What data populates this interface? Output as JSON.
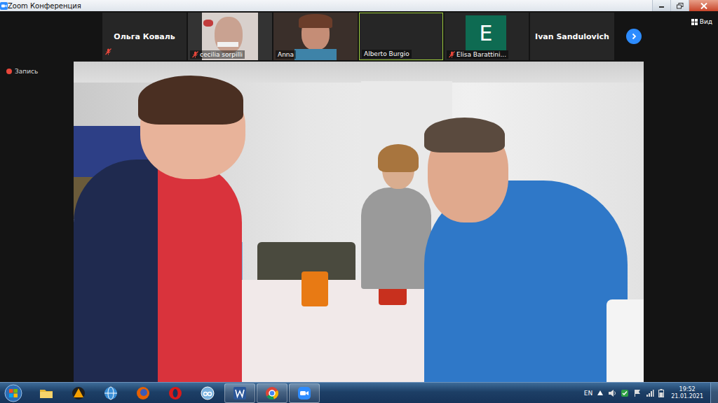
{
  "window": {
    "title": "Zoom Конференция"
  },
  "participants": [
    {
      "name": "Ольга Коваль",
      "kind": "name",
      "muted": true,
      "active_speaker": false
    },
    {
      "name": "cecilia sorpilli",
      "kind": "video",
      "muted": true,
      "active_speaker": false
    },
    {
      "name": "Anna",
      "kind": "video",
      "muted": false,
      "active_speaker": false
    },
    {
      "name": "Alberto Burgio",
      "kind": "blank",
      "muted": false,
      "active_speaker": true
    },
    {
      "name": "Elisa Barattini...",
      "kind": "avatar",
      "avatar": "E",
      "muted": true,
      "active_speaker": false
    },
    {
      "name": "Ivan Sandulovich",
      "kind": "name",
      "muted": false,
      "active_speaker": false
    }
  ],
  "view_button": {
    "label": "Вид"
  },
  "recording": {
    "label": "Запись"
  },
  "taskbar": {
    "apps": [
      {
        "kind": "explorer",
        "running": false
      },
      {
        "kind": "aimp",
        "running": false
      },
      {
        "kind": "network",
        "running": false
      },
      {
        "kind": "firefox",
        "running": false
      },
      {
        "kind": "opera",
        "running": false
      },
      {
        "kind": "qbittorrent",
        "running": false
      },
      {
        "kind": "word",
        "running": true
      },
      {
        "kind": "chrome",
        "running": true
      },
      {
        "kind": "zoom",
        "running": true
      }
    ],
    "language": "EN",
    "time": "19:52",
    "date": "21.01.2021"
  }
}
